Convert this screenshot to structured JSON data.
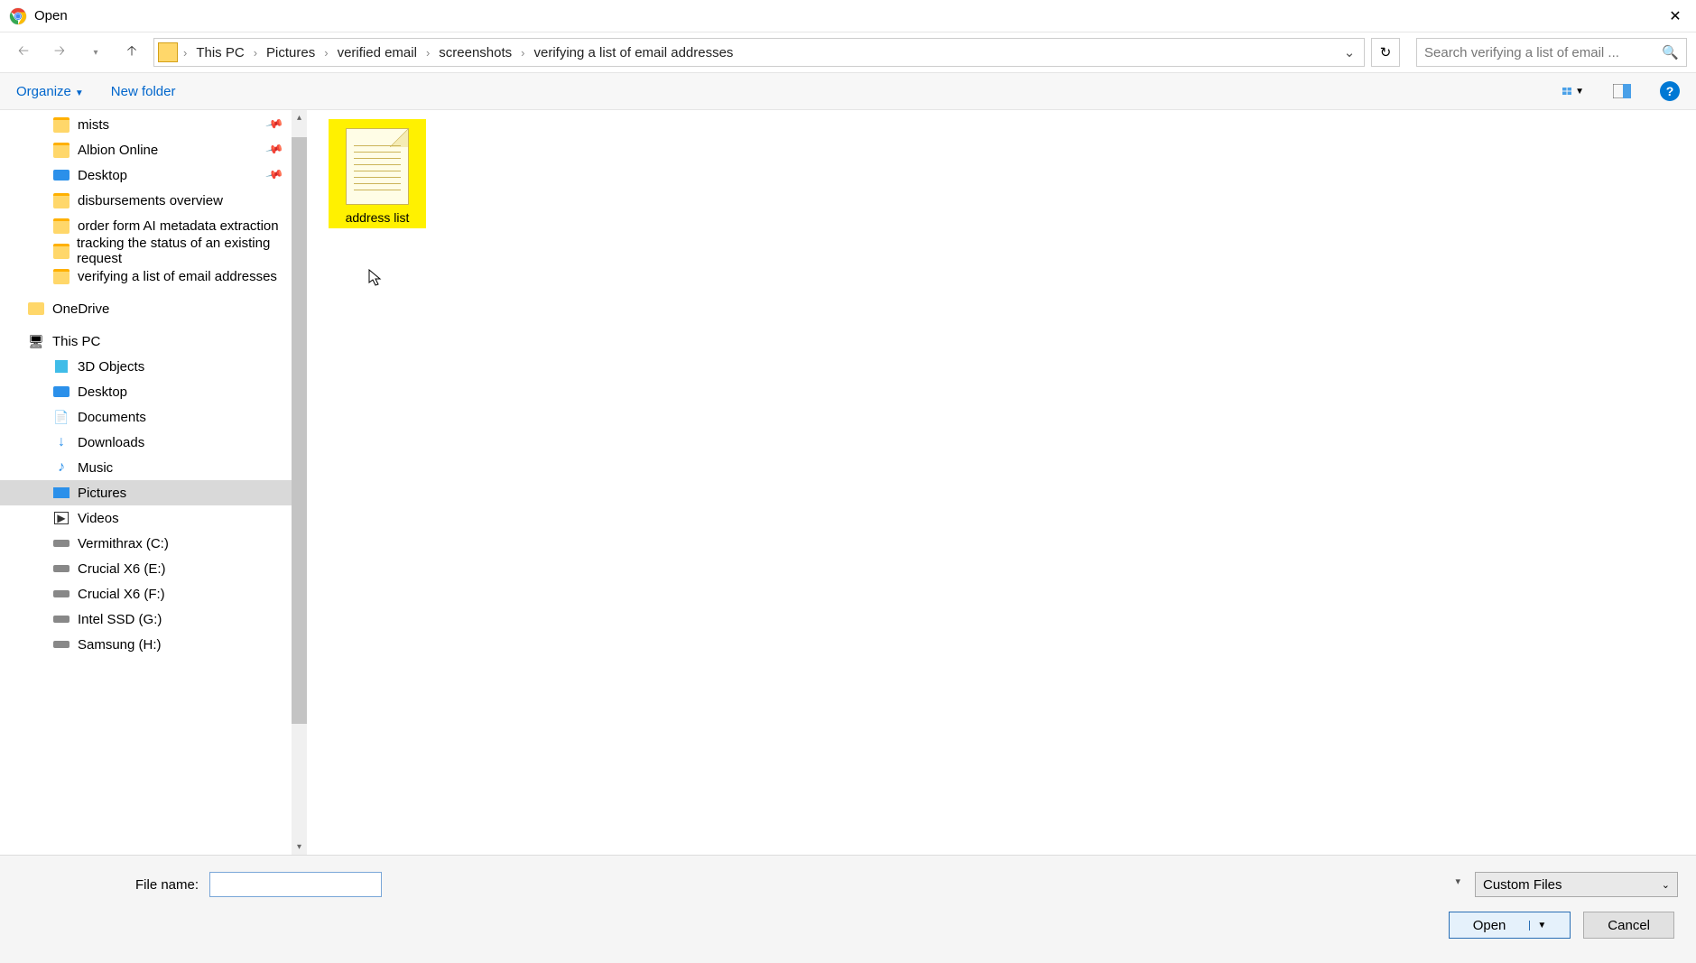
{
  "window": {
    "title": "Open"
  },
  "breadcrumb": [
    "This PC",
    "Pictures",
    "verified email",
    "screenshots",
    "verifying a list of email addresses"
  ],
  "search_placeholder": "Search verifying a list of email ...",
  "toolbar": {
    "organize": "Organize",
    "newfolder": "New folder"
  },
  "quick_access": [
    {
      "label": "mists",
      "pinned": true,
      "icon": "folder"
    },
    {
      "label": "Albion Online",
      "pinned": true,
      "icon": "folder"
    },
    {
      "label": "Desktop",
      "pinned": true,
      "icon": "desktop"
    },
    {
      "label": "disbursements overview",
      "pinned": false,
      "icon": "folder"
    },
    {
      "label": "order form AI metadata extraction",
      "pinned": false,
      "icon": "folder"
    },
    {
      "label": "tracking the status of an existing request",
      "pinned": false,
      "icon": "folder"
    },
    {
      "label": "verifying a list of email addresses",
      "pinned": false,
      "icon": "folder"
    }
  ],
  "onedrive": {
    "label": "OneDrive"
  },
  "thispc": {
    "label": "This PC",
    "children": [
      {
        "label": "3D Objects",
        "icon": "obj"
      },
      {
        "label": "Desktop",
        "icon": "desktop"
      },
      {
        "label": "Documents",
        "icon": "doc"
      },
      {
        "label": "Downloads",
        "icon": "down"
      },
      {
        "label": "Music",
        "icon": "music"
      },
      {
        "label": "Pictures",
        "icon": "pic",
        "selected": true
      },
      {
        "label": "Videos",
        "icon": "vid"
      },
      {
        "label": "Vermithrax (C:)",
        "icon": "drive"
      },
      {
        "label": "Crucial X6 (E:)",
        "icon": "drive"
      },
      {
        "label": "Crucial X6 (F:)",
        "icon": "drive"
      },
      {
        "label": "Intel SSD (G:)",
        "icon": "drive"
      },
      {
        "label": "Samsung (H:)",
        "icon": "drive"
      }
    ]
  },
  "files": [
    {
      "name": "address list",
      "highlighted": true
    }
  ],
  "filename_label": "File name:",
  "filename_value": "",
  "filetype": "Custom Files",
  "buttons": {
    "open": "Open",
    "cancel": "Cancel"
  }
}
